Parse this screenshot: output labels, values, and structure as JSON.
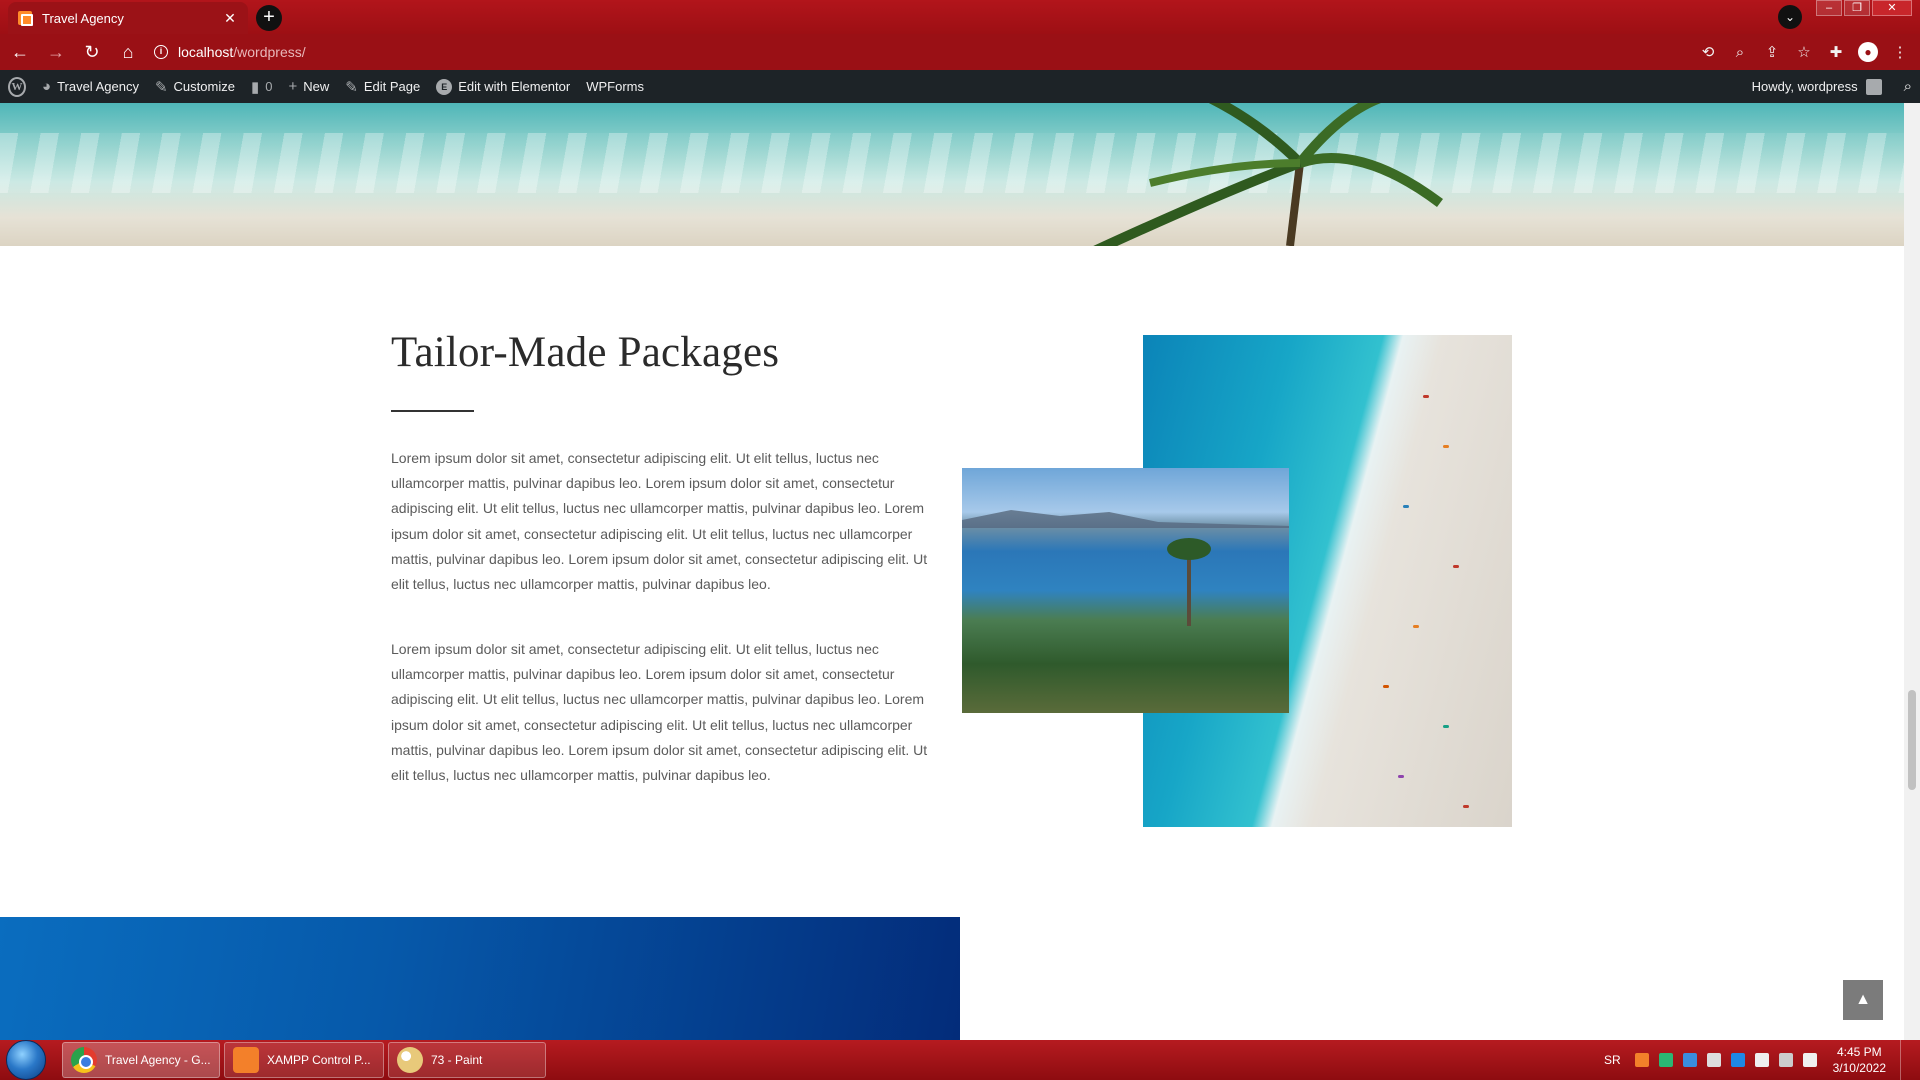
{
  "browser": {
    "tab_title": "Travel Agency",
    "tab_close": "✕",
    "new_tab": "+",
    "url_host": "localhost",
    "url_path": "/wordpress/",
    "window_controls": [
      "–",
      "❐",
      "✕"
    ]
  },
  "admin_bar": {
    "site_name": "Travel Agency",
    "customize": "Customize",
    "comments_count": "0",
    "new": "New",
    "edit_page": "Edit Page",
    "edit_elementor": "Edit with Elementor",
    "wpforms": "WPForms",
    "howdy": "Howdy, wordpress"
  },
  "section": {
    "title": "Tailor-Made Packages",
    "paragraph1": "Lorem ipsum dolor sit amet, consectetur adipiscing elit. Ut elit tellus, luctus nec ullamcorper mattis, pulvinar dapibus leo. Lorem ipsum dolor sit amet, consectetur adipiscing elit. Ut elit tellus, luctus nec ullamcorper mattis, pulvinar dapibus leo. Lorem ipsum dolor sit amet, consectetur adipiscing elit. Ut elit tellus, luctus nec ullamcorper mattis, pulvinar dapibus leo. Lorem ipsum dolor sit amet, consectetur adipiscing elit. Ut elit tellus, luctus nec ullamcorper mattis, pulvinar dapibus leo.",
    "paragraph2": "Lorem ipsum dolor sit amet, consectetur adipiscing elit. Ut elit tellus, luctus nec ullamcorper mattis, pulvinar dapibus leo. Lorem ipsum dolor sit amet, consectetur adipiscing elit. Ut elit tellus, luctus nec ullamcorper mattis, pulvinar dapibus leo. Lorem ipsum dolor sit amet, consectetur adipiscing elit. Ut elit tellus, luctus nec ullamcorper mattis, pulvinar dapibus leo. Lorem ipsum dolor sit amet, consectetur adipiscing elit. Ut elit tellus, luctus nec ullamcorper mattis, pulvinar dapibus leo."
  },
  "icons": {
    "back": "arrow-left-icon",
    "forward": "arrow-right-icon",
    "reload": "reload-icon",
    "home": "home-icon",
    "scroll_top": "chevron-up-icon"
  },
  "taskbar": {
    "items": [
      "Travel Agency - G...",
      "XAMPP Control P...",
      "73 - Paint"
    ],
    "language": "SR",
    "time": "4:45 PM",
    "date": "3/10/2022"
  },
  "colors": {
    "browser_frame": "#9a1015",
    "admin_bar": "#1d2327",
    "heading": "#2b2b2b",
    "body_text": "#5b5b5b",
    "footer_band": "#0659aa"
  }
}
